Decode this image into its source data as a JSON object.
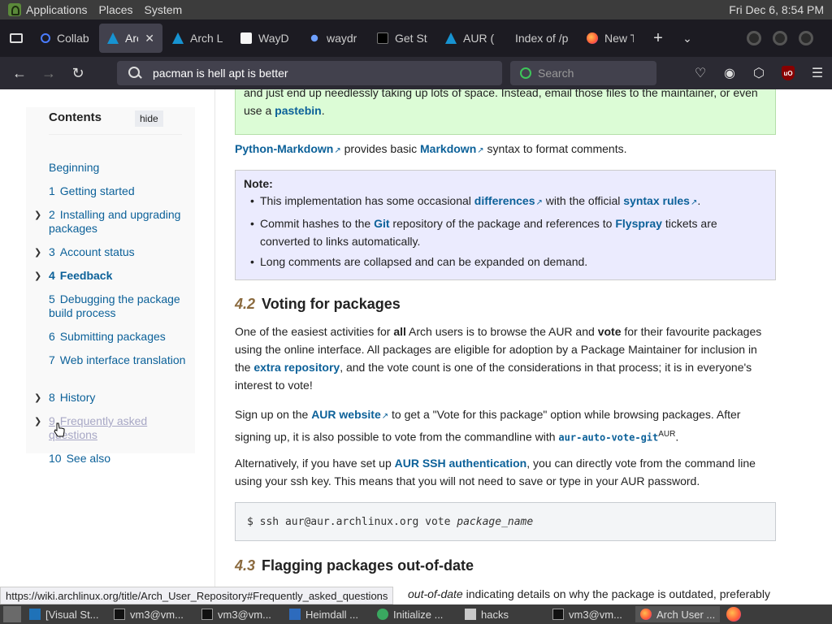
{
  "top_panel": {
    "menus": [
      "Applications",
      "Places",
      "System"
    ],
    "clock": "Fri Dec  6,  8:54 PM"
  },
  "tabs": [
    {
      "label": "Collab",
      "icon": "search-icon"
    },
    {
      "label": "Arch",
      "icon": "arch-icon",
      "active": true
    },
    {
      "label": "Arch L",
      "icon": "arch-icon"
    },
    {
      "label": "WayD",
      "icon": "doc-icon"
    },
    {
      "label": "waydr",
      "icon": "globe-icon"
    },
    {
      "label": "Get St",
      "icon": "terminal-icon"
    },
    {
      "label": "AUR (",
      "icon": "arch-icon"
    },
    {
      "label": "Index of /p",
      "icon": ""
    },
    {
      "label": "New T",
      "icon": "firefox-icon"
    }
  ],
  "navbar": {
    "url_value": "pacman is hell apt is better",
    "search_placeholder": "Search"
  },
  "toc": {
    "heading": "Contents",
    "hide_label": "hide",
    "items": [
      {
        "num": "",
        "label": "Beginning",
        "expandable": false
      },
      {
        "num": "1",
        "label": "Getting started",
        "expandable": false
      },
      {
        "num": "2",
        "label": "Installing and upgrading packages",
        "expandable": true
      },
      {
        "num": "3",
        "label": "Account status",
        "expandable": true
      },
      {
        "num": "4",
        "label": "Feedback",
        "expandable": true,
        "current": true
      },
      {
        "num": "5",
        "label": "Debugging the package build process",
        "expandable": false
      },
      {
        "num": "6",
        "label": "Submitting packages",
        "expandable": false
      },
      {
        "num": "7",
        "label": "Web interface translation",
        "expandable": false
      },
      {
        "num": "8",
        "label": "History",
        "expandable": true
      },
      {
        "num": "9",
        "label": "Frequently asked questions",
        "expandable": true,
        "visited": true
      },
      {
        "num": "10",
        "label": "See also",
        "expandable": false
      }
    ]
  },
  "article": {
    "green_box": {
      "text1": "and just end up needlessly taking up lots of space. Instead, email those files to the maintainer, or even use a ",
      "link": "pastebin",
      "text2": "."
    },
    "markdown_para": {
      "link1": "Python-Markdown",
      "text1": " provides basic ",
      "link2": "Markdown",
      "text2": " syntax to format comments."
    },
    "note": {
      "title": "Note:",
      "b1_text1": "This implementation has some occasional ",
      "b1_link1": "differences",
      "b1_text2": " with the official ",
      "b1_link2": "syntax rules",
      "b1_text3": ".",
      "b2_text1": "Commit hashes to the ",
      "b2_link1": "Git",
      "b2_text2": " repository of the package and references to ",
      "b2_link2": "Flyspray",
      "b2_text3": " tickets are converted to links automatically.",
      "b3_text": "Long comments are collapsed and can be expanded on demand."
    },
    "section_42": {
      "num": "4.2",
      "title": "Voting for packages"
    },
    "voting_para": {
      "t1": "One of the easiest activities for ",
      "b1": "all",
      "t2": " Arch users is to browse the AUR and ",
      "b2": "vote",
      "t3": " for their favourite packages using the online interface. All packages are eligible for adoption by a Package Maintainer for inclusion in the ",
      "link": "extra repository",
      "t4": ", and the vote count is one of the considerations in that process; it is in everyone's interest to vote!"
    },
    "signup_para": {
      "t1": "Sign up on the ",
      "link": "AUR website",
      "t2": " to get a \"Vote for this package\" option while browsing packages. After signing up, it is also possible to vote from the commandline with ",
      "code": "aur-auto-vote-git",
      "sup": "AUR",
      "t3": "."
    },
    "ssh_para": {
      "t1": "Alternatively, if you have set up ",
      "link": "AUR SSH authentication",
      "t2": ", you can directly vote from the command line using your ssh key. This means that you will not need to save or type in your AUR password."
    },
    "code_block": {
      "cmd": "$ ssh aur@aur.archlinux.org vote ",
      "arg": "package_name"
    },
    "section_43": {
      "num": "4.3",
      "title": "Flagging packages out-of-date"
    },
    "last_line": {
      "em": "out-of-date",
      "t": " indicating details on why the package is outdated, preferably"
    }
  },
  "status_link": "https://wiki.archlinux.org/title/Arch_User_Repository#Frequently_asked_questions",
  "taskbar": [
    {
      "label": "[Visual St...",
      "icon": "vscode-icon"
    },
    {
      "label": "vm3@vm...",
      "icon": "terminal-icon"
    },
    {
      "label": "vm3@vm...",
      "icon": "terminal-icon"
    },
    {
      "label": "Heimdall ...",
      "icon": "text-editor-icon"
    },
    {
      "label": "Initialize ...",
      "icon": "green-app-icon"
    },
    {
      "label": "hacks",
      "icon": "folder-icon"
    },
    {
      "label": "vm3@vm...",
      "icon": "terminal-icon"
    },
    {
      "label": "Arch User ...",
      "icon": "firefox-icon",
      "active": true
    }
  ]
}
